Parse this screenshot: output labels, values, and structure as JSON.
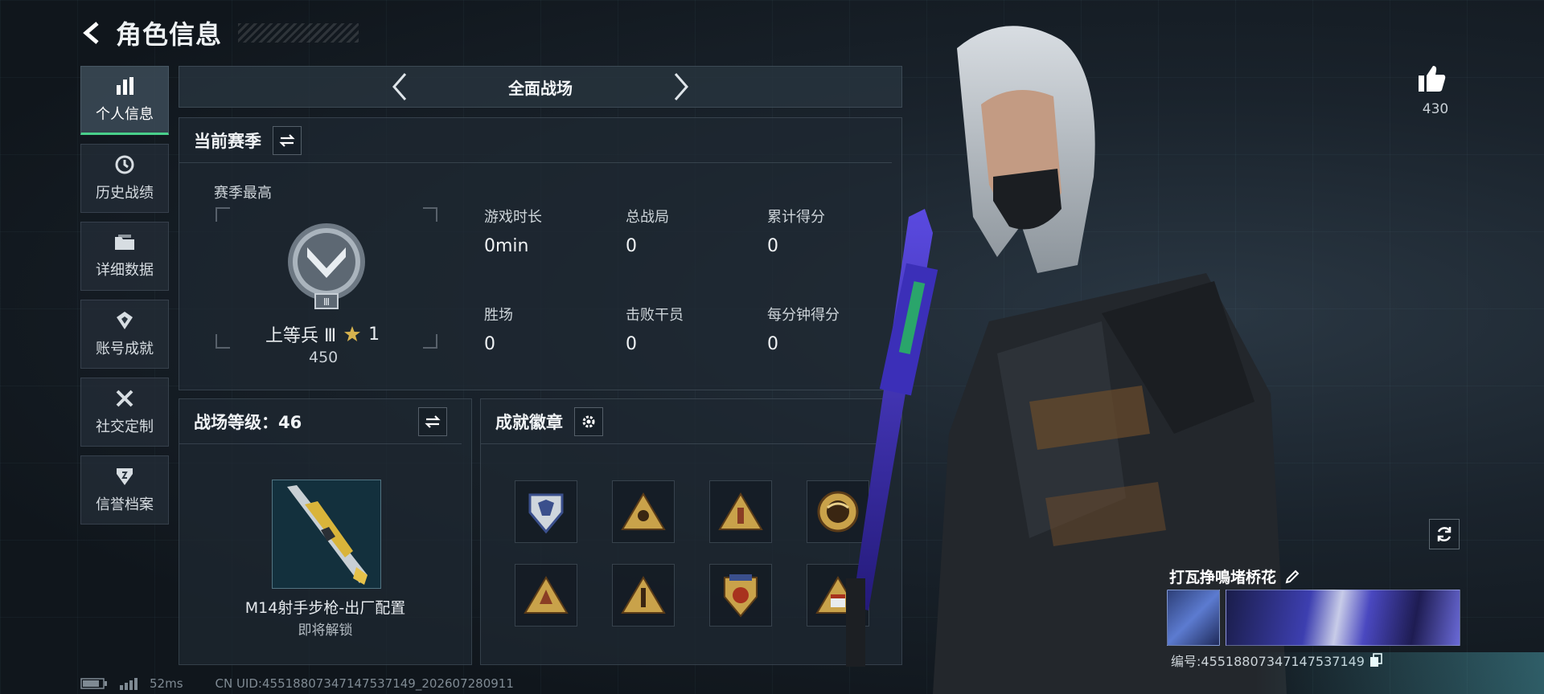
{
  "header": {
    "title": "角色信息"
  },
  "sidebar": {
    "items": [
      {
        "label": "个人信息",
        "icon": "bar-chart-icon",
        "active": true
      },
      {
        "label": "历史战绩",
        "icon": "history-icon"
      },
      {
        "label": "详细数据",
        "icon": "folder-icon"
      },
      {
        "label": "账号成就",
        "icon": "achievement-icon"
      },
      {
        "label": "社交定制",
        "icon": "tools-icon"
      },
      {
        "label": "信誉档案",
        "icon": "shield-icon"
      }
    ]
  },
  "mode": {
    "title": "全面战场"
  },
  "season": {
    "header": "当前赛季",
    "best_label": "赛季最高",
    "rank_name": "上等兵 Ⅲ",
    "rank_stars": "1",
    "rank_points": "450",
    "stats": [
      {
        "label": "游戏时长",
        "value": "0min"
      },
      {
        "label": "总战局",
        "value": "0"
      },
      {
        "label": "累计得分",
        "value": "0"
      },
      {
        "label": "胜场",
        "value": "0"
      },
      {
        "label": "击败干员",
        "value": "0"
      },
      {
        "label": "每分钟得分",
        "value": "0"
      }
    ]
  },
  "battlefield": {
    "header": "战场等级：46",
    "weapon_name": "M14射手步枪-出厂配置",
    "weapon_status": "即将解锁"
  },
  "achievements": {
    "header": "成就徽章",
    "badges": [
      "shield-badge-icon",
      "triangle-badge-icon",
      "triangle-badge-icon",
      "circle-badge-icon",
      "triangle-badge-icon",
      "triangle-badge-icon",
      "crest-badge-icon",
      "triangle-badge-icon"
    ]
  },
  "likes": {
    "count": "430"
  },
  "player": {
    "name": "打瓦挣鳴堵桥花",
    "id": "编号:4551880734714753714​9"
  },
  "footer": {
    "ping": "52ms",
    "uid": "CN UID:4551880734714753714​9_202607280911"
  },
  "colors": {
    "accent": "#49d08b",
    "gold": "#c9a24a"
  }
}
